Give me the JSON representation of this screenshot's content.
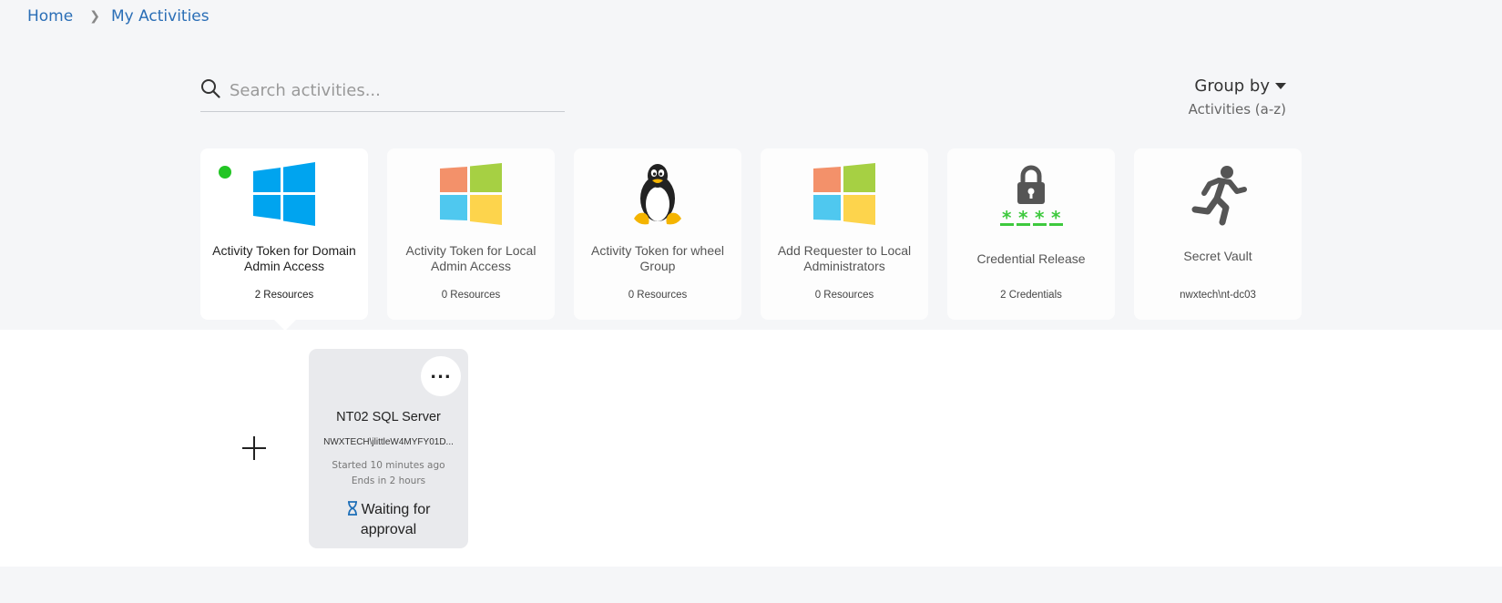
{
  "breadcrumb": {
    "home": "Home",
    "current": "My Activities"
  },
  "search": {
    "placeholder": "Search activities...",
    "value": ""
  },
  "group_by": {
    "label": "Group by",
    "value": "Activities (a-z)"
  },
  "activities": [
    {
      "title": "Activity Token for Domain Admin Access",
      "meta": "2 Resources",
      "icon": "windows-blue-icon",
      "selected": true,
      "active": true
    },
    {
      "title": "Activity Token for Local Admin Access",
      "meta": "0 Resources",
      "icon": "windows-color-icon"
    },
    {
      "title": "Activity Token for wheel Group",
      "meta": "0 Resources",
      "icon": "linux-penguin-icon"
    },
    {
      "title": "Add Requester to Local Administrators",
      "meta": "0 Resources",
      "icon": "windows-color-icon"
    },
    {
      "title": "Credential Release",
      "meta": "2 Credentials",
      "icon": "lock-password-icon"
    },
    {
      "title": "Secret Vault",
      "meta": "nwxtech\\nt-dc03",
      "icon": "running-person-icon"
    }
  ],
  "resource": {
    "title": "NT02 SQL Server",
    "account": "NWXTECH\\jlittleW4MYFY01D...",
    "started": "Started 10 minutes ago",
    "ends": "Ends in 2 hours",
    "status": "Waiting for approval",
    "more_label": "..."
  },
  "colors": {
    "link": "#2a6eb6",
    "active_dot": "#22c524",
    "hourglass": "#1e6fb8",
    "password_green": "#3ec93e"
  }
}
